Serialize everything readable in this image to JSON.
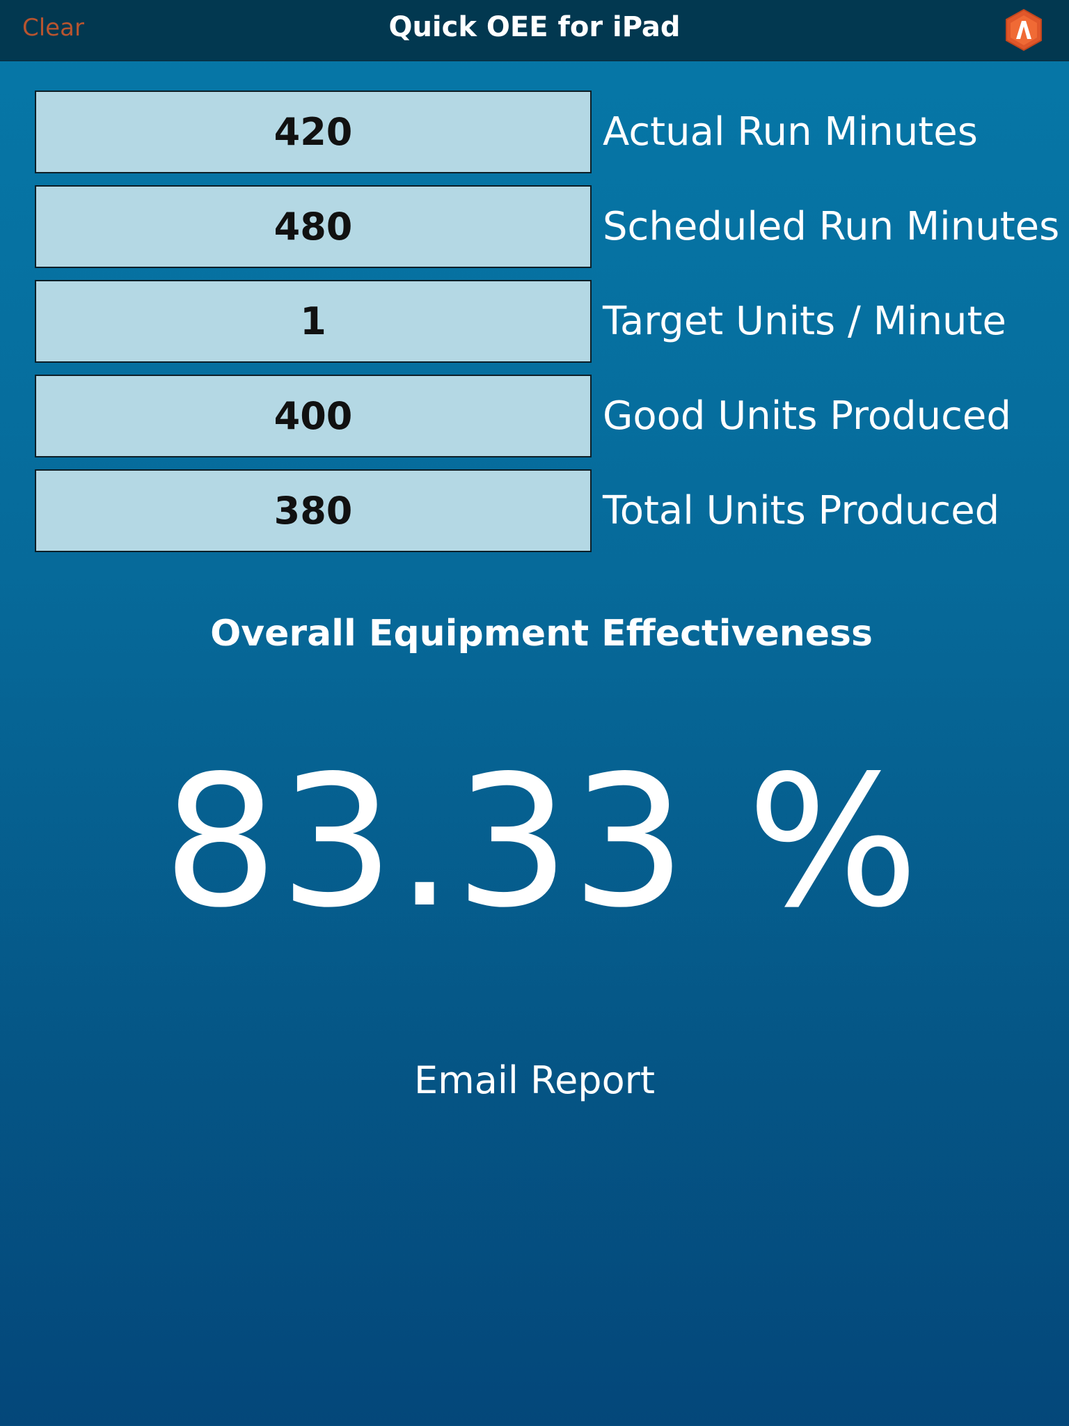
{
  "navbar": {
    "clear_label": "Clear",
    "title": "Quick OEE for iPad",
    "logo_icon": "app-logo-icon",
    "logo_color": "#e0572a"
  },
  "inputs": [
    {
      "value": "420",
      "label": "Actual Run Minutes"
    },
    {
      "value": "480",
      "label": "Scheduled Run Minutes"
    },
    {
      "value": "1",
      "label": "Target Units / Minute"
    },
    {
      "value": "400",
      "label": "Good Units Produced"
    },
    {
      "value": "380",
      "label": "Total Units Produced"
    }
  ],
  "result": {
    "title": "Overall Equipment Effectiveness",
    "value": "83.33 %"
  },
  "actions": {
    "email_label": "Email Report"
  },
  "colors": {
    "background_top": "#0678a8",
    "background_bottom": "#04477a",
    "navbar": "#023850",
    "field_bg": "#b4d8e4",
    "clear_text": "#b8542f"
  }
}
